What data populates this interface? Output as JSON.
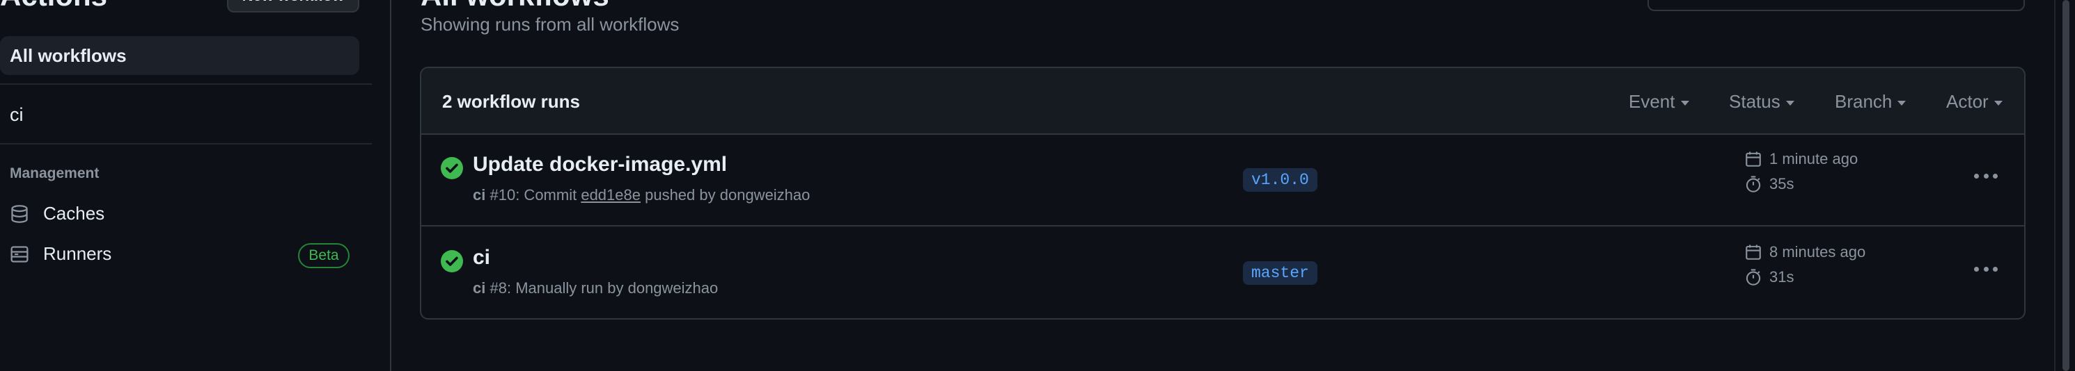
{
  "sidebar": {
    "title": "Actions",
    "new_workflow_label": "New workflow",
    "all_workflows_label": "All workflows",
    "workflows": [
      "ci"
    ],
    "management_label": "Management",
    "items": [
      {
        "label": "Caches",
        "icon": "database-icon"
      },
      {
        "label": "Runners",
        "icon": "server-icon",
        "badge": "Beta"
      }
    ]
  },
  "main": {
    "title": "All workflows",
    "subtitle": "Showing runs from all workflows"
  },
  "runs_panel": {
    "count_label": "2 workflow runs",
    "filters": [
      "Event",
      "Status",
      "Branch",
      "Actor"
    ]
  },
  "runs": [
    {
      "title": "Update docker-image.yml",
      "workflow": "ci",
      "run_number": "#10",
      "meta_prefix": ": Commit ",
      "commit": "edd1e8e",
      "meta_suffix": " pushed by dongweizhao",
      "branch": "v1.0.0",
      "time": "1 minute ago",
      "duration": "35s",
      "status": "success"
    },
    {
      "title": "ci",
      "workflow": "ci",
      "run_number": "#8",
      "meta_prefix": ": Manually run by dongweizhao",
      "commit": "",
      "meta_suffix": "",
      "branch": "master",
      "time": "8 minutes ago",
      "duration": "31s",
      "status": "success"
    }
  ],
  "colors": {
    "background": "#0d1117",
    "success": "#3fb950",
    "branch_text": "#58a6ff",
    "muted_text": "#8b949e"
  }
}
